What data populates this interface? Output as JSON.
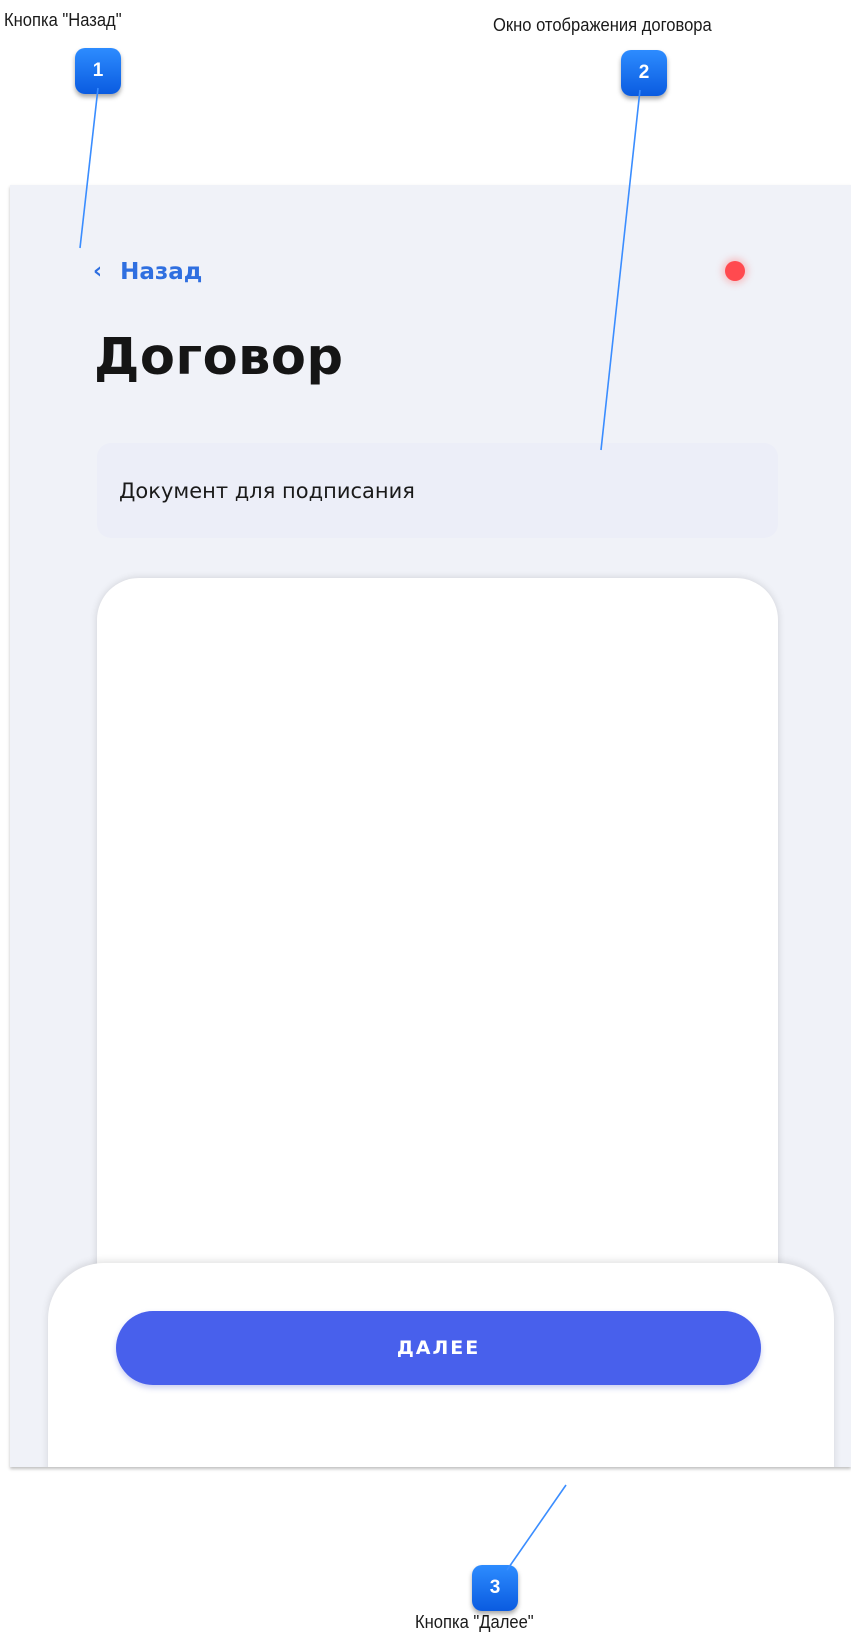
{
  "annotations": [
    {
      "number": "1",
      "label": "Кнопка \"Назад\""
    },
    {
      "number": "2",
      "label": "Окно отображения договора"
    },
    {
      "number": "3",
      "label": "Кнопка \"Далее\""
    }
  ],
  "screen": {
    "back_label": "Назад",
    "back_icon": "chevron-left-icon",
    "status_color": "#ff4a4f",
    "title": "Договор",
    "document_header": "Документ для подписания",
    "next_label": "ДАЛЕЕ",
    "accent_color": "#4860ec",
    "link_color": "#2f6fe0"
  }
}
